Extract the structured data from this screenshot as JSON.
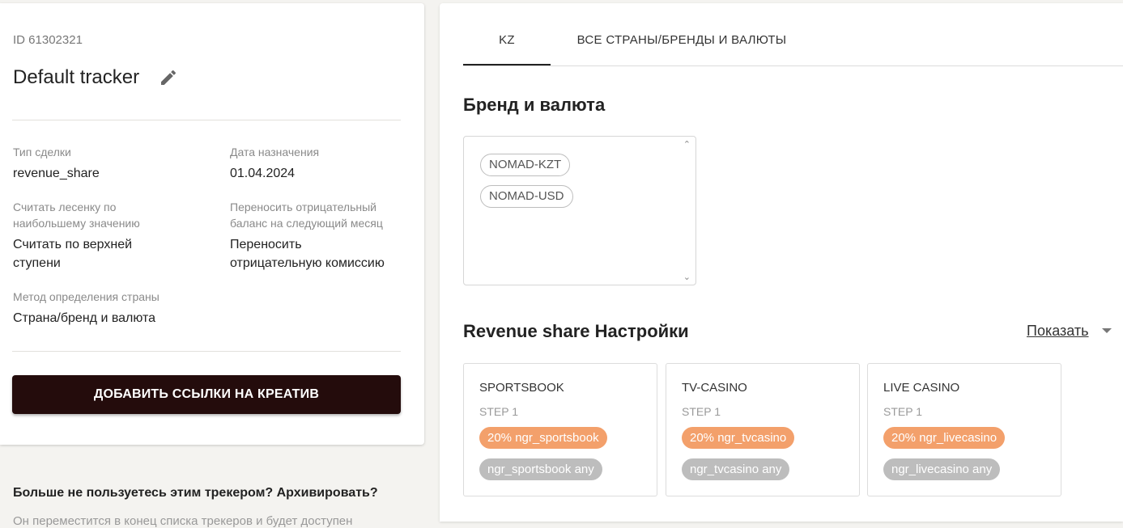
{
  "tracker": {
    "id_text": "ID 61302321",
    "title": "Default tracker",
    "deal_type_label": "Тип сделки",
    "deal_type_value": "revenue_share",
    "assign_date_label": "Дата назначения",
    "assign_date_value": "01.04.2024",
    "ladder_label_1": "Считать лесенку по",
    "ladder_label_2": "наибольшему значению",
    "ladder_value_1": "Считать по верхней",
    "ladder_value_2": "ступени",
    "carry_label_1": "Переносить отрицательный",
    "carry_label_2": "баланс на следующий месяц",
    "carry_value_1": "Переносить",
    "carry_value_2": "отрицательную комиссию",
    "country_method_label": "Метод определения страны",
    "country_method_value": "Страна/бренд и валюта",
    "add_links_button": "ДОБАВИТЬ ССЫЛКИ НА КРЕАТИВ",
    "archive_question": "Больше не пользуетесь этим трекером? Архивировать?",
    "archive_description": "Он переместится в конец списка трекеров и будет доступен"
  },
  "tabs": [
    {
      "label": "KZ",
      "active": true
    },
    {
      "label": "ВСЕ СТРАНЫ/БРЕНДЫ И ВАЛЮТЫ",
      "active": false
    }
  ],
  "brand_section": {
    "title": "Бренд и валюта",
    "chips": [
      "NOMAD-KZT",
      "NOMAD-USD"
    ]
  },
  "revenue_section": {
    "title": "Revenue share Настройки",
    "show_label": "Показать",
    "cards": [
      {
        "name": "SPORTSBOOK",
        "step": "STEP 1",
        "rate": "20% ngr_sportsbook",
        "scope": "ngr_sportsbook any"
      },
      {
        "name": "TV-CASINO",
        "step": "STEP 1",
        "rate": "20% ngr_tvcasino",
        "scope": "ngr_tvcasino any"
      },
      {
        "name": "LIVE CASINO",
        "step": "STEP 1",
        "rate": "20% ngr_livecasino",
        "scope": "ngr_livecasino any"
      }
    ]
  },
  "colors": {
    "primary_button": "#240c0c",
    "rate_pill": "#f3a06b",
    "scope_pill": "#bdbdbd",
    "page_background": "#f4f3f0"
  },
  "icons": {
    "edit": "pencil-icon",
    "show_toggle": "caret-down-icon",
    "scroll_up": "chevron-up-icon",
    "scroll_down": "chevron-down-icon"
  }
}
